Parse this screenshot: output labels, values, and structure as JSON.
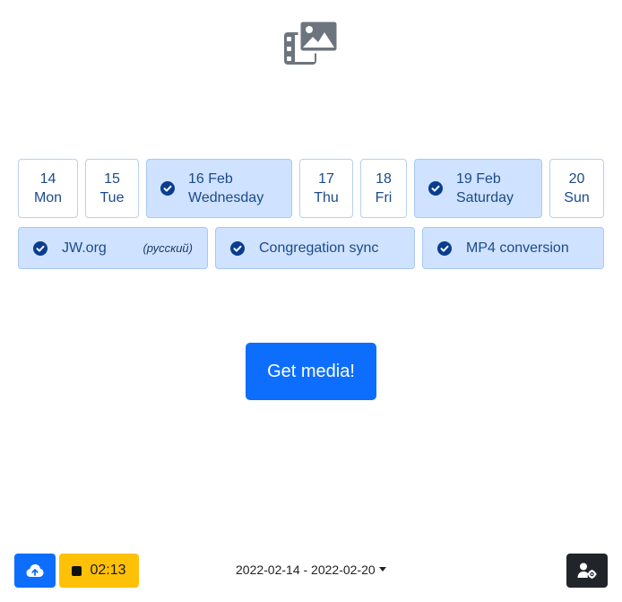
{
  "logo": {
    "icon": "photo-film-icon",
    "color": "#6c757d"
  },
  "days": [
    {
      "num": "14",
      "name": "Mon",
      "selected": false
    },
    {
      "num": "15",
      "name": "Tue",
      "selected": false
    },
    {
      "num": "16 Feb",
      "name": "Wednesday",
      "selected": true
    },
    {
      "num": "17",
      "name": "Thu",
      "selected": false
    },
    {
      "num": "18",
      "name": "Fri",
      "selected": false
    },
    {
      "num": "19 Feb",
      "name": "Saturday",
      "selected": true
    },
    {
      "num": "20",
      "name": "Sun",
      "selected": false
    }
  ],
  "tasks": [
    {
      "label": "JW.org",
      "lang": "(русский)",
      "checked": true
    },
    {
      "label": "Congregation sync",
      "checked": true
    },
    {
      "label": "MP4 conversion",
      "checked": true
    }
  ],
  "main": {
    "get_media_label": "Get media!"
  },
  "footer": {
    "upload_icon": "cloud-upload-icon",
    "timer": "02:13",
    "date_range": "2022-02-14 - 2022-02-20",
    "settings_icon": "user-gear-icon"
  },
  "colors": {
    "primary": "#0d6efd",
    "selected_bg": "#cfe2ff",
    "warning": "#ffc107",
    "dark": "#212529"
  }
}
